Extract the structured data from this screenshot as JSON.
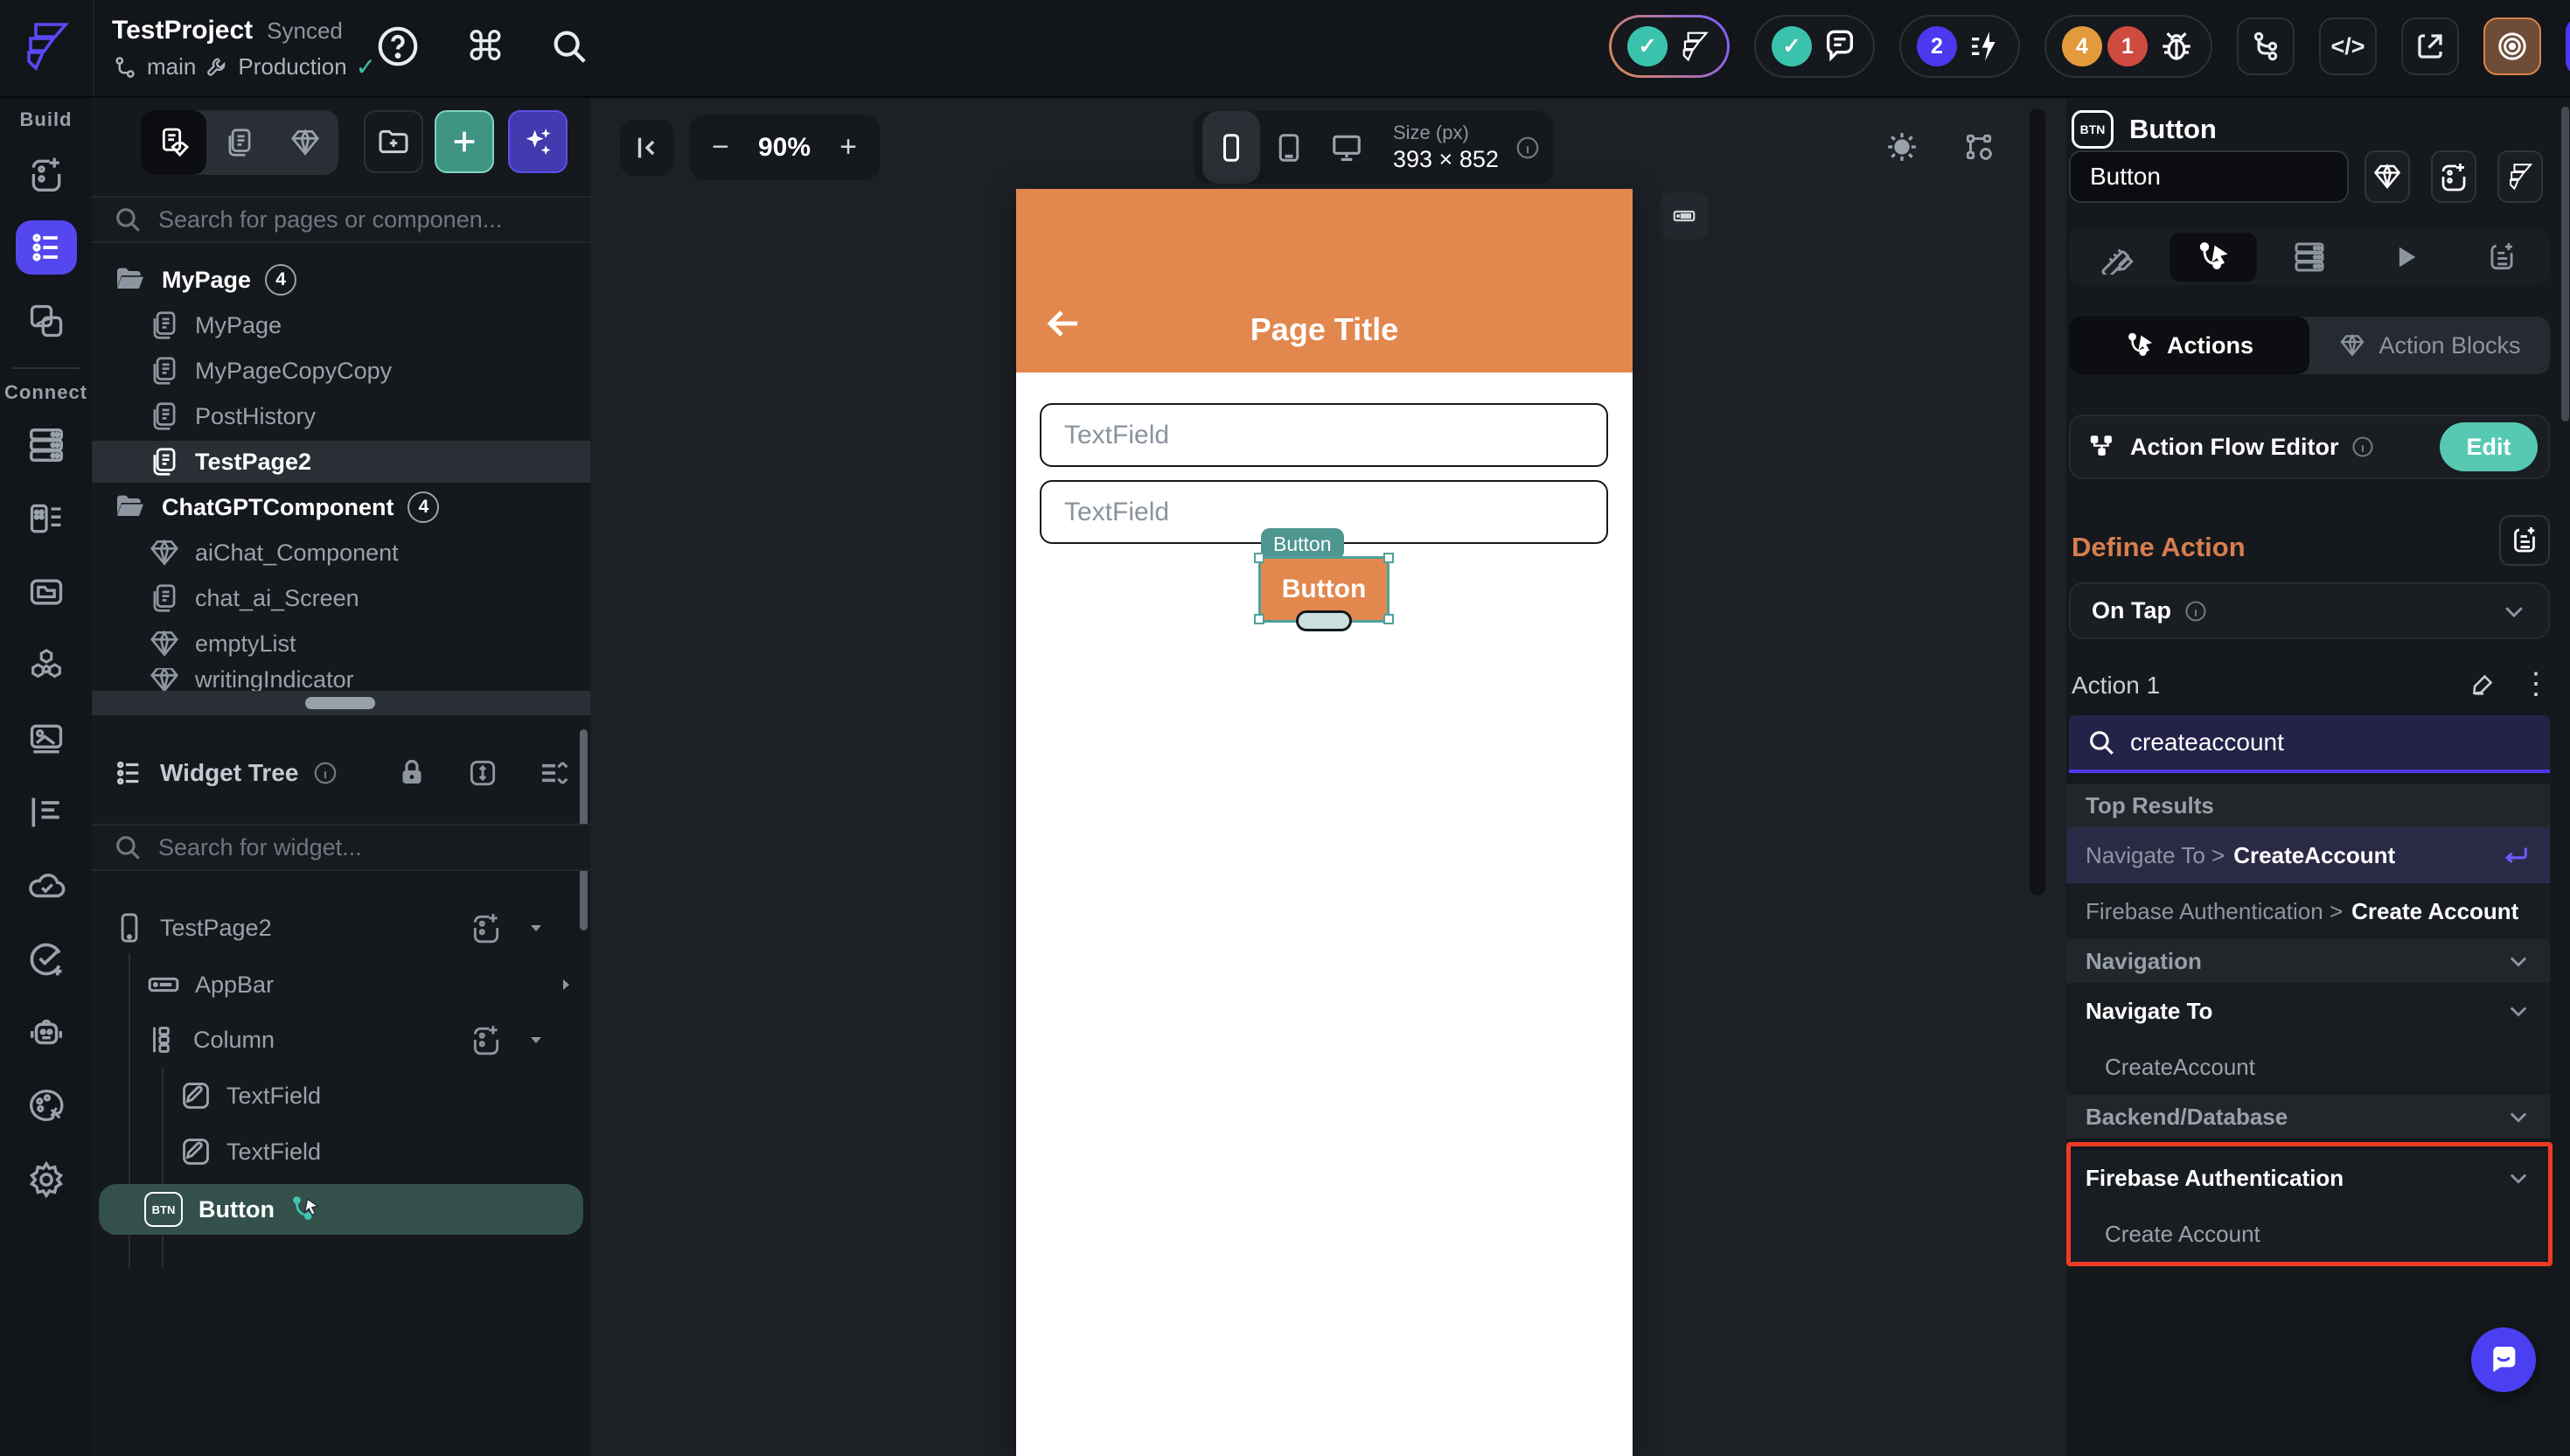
{
  "topbar": {
    "project_name": "TestProject",
    "sync_status": "Synced",
    "branch": "main",
    "environment": "Production",
    "counts": {
      "automations": "2",
      "warnings": "4",
      "errors": "1"
    },
    "code_icon_label": "</>"
  },
  "glyphs": {
    "command": "⌘",
    "check": "✓",
    "dots": "⋮",
    "chevron_right": "▸",
    "back_arrow": "←",
    "btn_chip": "BTN"
  },
  "rail": {
    "build_label": "Build",
    "connect_label": "Connect"
  },
  "pages": {
    "search_placeholder": "Search for pages or componen...",
    "folder1": {
      "name": "MyPage",
      "count": "4",
      "items": [
        "MyPage",
        "MyPageCopyCopy",
        "PostHistory",
        "TestPage2"
      ]
    },
    "folder2": {
      "name": "ChatGPTComponent",
      "count": "4",
      "items": [
        "aiChat_Component",
        "chat_ai_Screen",
        "emptyList",
        "writingIndicator"
      ]
    }
  },
  "tree": {
    "title": "Widget Tree",
    "search_placeholder": "Search for widget...",
    "nodes": {
      "root": "TestPage2",
      "appbar": "AppBar",
      "column": "Column",
      "tf1": "TextField",
      "tf2": "TextField",
      "button": "Button"
    }
  },
  "canvas": {
    "zoom": "90%",
    "zoom_out": "−",
    "zoom_in": "+",
    "size_label": "Size (px)",
    "size_value": "393 × 852",
    "phone": {
      "title": "Page Title",
      "tf1_placeholder": "TextField",
      "tf2_placeholder": "TextField",
      "button_label": "Button",
      "selection_tag": "Button"
    }
  },
  "props": {
    "widget_type": "Button",
    "name_value": "Button",
    "tabs": {
      "actions": "Actions",
      "blocks": "Action Blocks"
    },
    "afe": {
      "label": "Action Flow Editor",
      "edit": "Edit"
    },
    "define": {
      "heading": "Define Action",
      "trigger": "On Tap",
      "action": "Action 1"
    },
    "search_value": "createaccount",
    "results": {
      "top_label": "Top Results",
      "r1_path": "Navigate To >",
      "r1_name": "CreateAccount",
      "r2_path": "Firebase Authentication >",
      "r2_name": "Create Account",
      "nav_header": "Navigation",
      "navigate_to": "Navigate To",
      "create_account_page": "CreateAccount",
      "backend_header": "Backend/Database",
      "firebase_auth": "Firebase Authentication",
      "create_account_action": "Create Account"
    }
  },
  "colors": {
    "accent_indigo": "#4B39EF",
    "accent_teal": "#41C4AE",
    "appbar_orange": "#E2884F",
    "annotation_red": "#EE3B24",
    "edit_teal": "#57C9B2"
  }
}
